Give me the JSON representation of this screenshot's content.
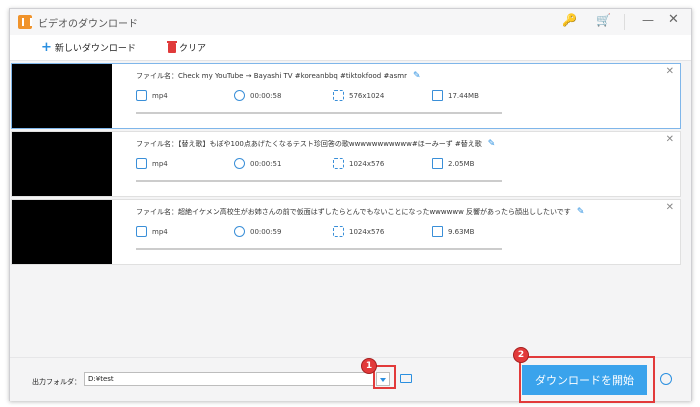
{
  "window": {
    "title": "ビデオのダウンロード"
  },
  "toolbar": {
    "new_download_label": "新しいダウンロード",
    "clear_label": "クリア"
  },
  "downloads": [
    {
      "filename": "ファイル名：Check my YouTube → Bayashi TV #koreanbbq #tiktokfood #asmr",
      "format": "mp4",
      "duration": "00:00:58",
      "resolution": "576x1024",
      "size": "17.44MB"
    },
    {
      "filename": "ファイル名：【替え歌】もぼや100点あげたくなるテスト珍回答の歌wwwwwwwwwww#ほーみーず #替え歌",
      "format": "mp4",
      "duration": "00:00:51",
      "resolution": "1024x576",
      "size": "2.05MB"
    },
    {
      "filename": "ファイル名：超絶イケメン高校生がお姉さんの前で仮面はずしたらとんでもないことになったwwwwww 反響があったら顔出ししたいです",
      "format": "mp4",
      "duration": "00:00:59",
      "resolution": "1024x576",
      "size": "9.63MB"
    }
  ],
  "output": {
    "label": "出力フォルダ：",
    "path": "D:¥test"
  },
  "start_button_label": "ダウンロードを開始",
  "annotations": {
    "badge1": "1",
    "badge2": "2"
  },
  "colors": {
    "accent": "#3aa3ec",
    "highlight": "#e23a3a"
  }
}
